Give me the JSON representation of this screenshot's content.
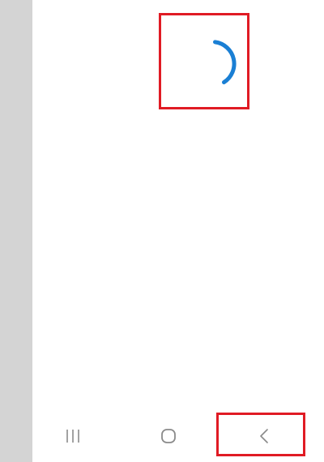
{
  "screen": {
    "state": "loading",
    "side_strip_color": "#d4d4d4",
    "background_color": "#ffffff"
  },
  "spinner": {
    "icon": "loading-spinner-icon",
    "color": "#1a7fd4"
  },
  "highlights": {
    "color": "#e01b24"
  },
  "navbar": {
    "buttons": [
      {
        "name": "recents",
        "icon": "recents-icon"
      },
      {
        "name": "home",
        "icon": "home-icon"
      },
      {
        "name": "back",
        "icon": "back-icon"
      }
    ],
    "icon_color": "#8a8a8a"
  }
}
